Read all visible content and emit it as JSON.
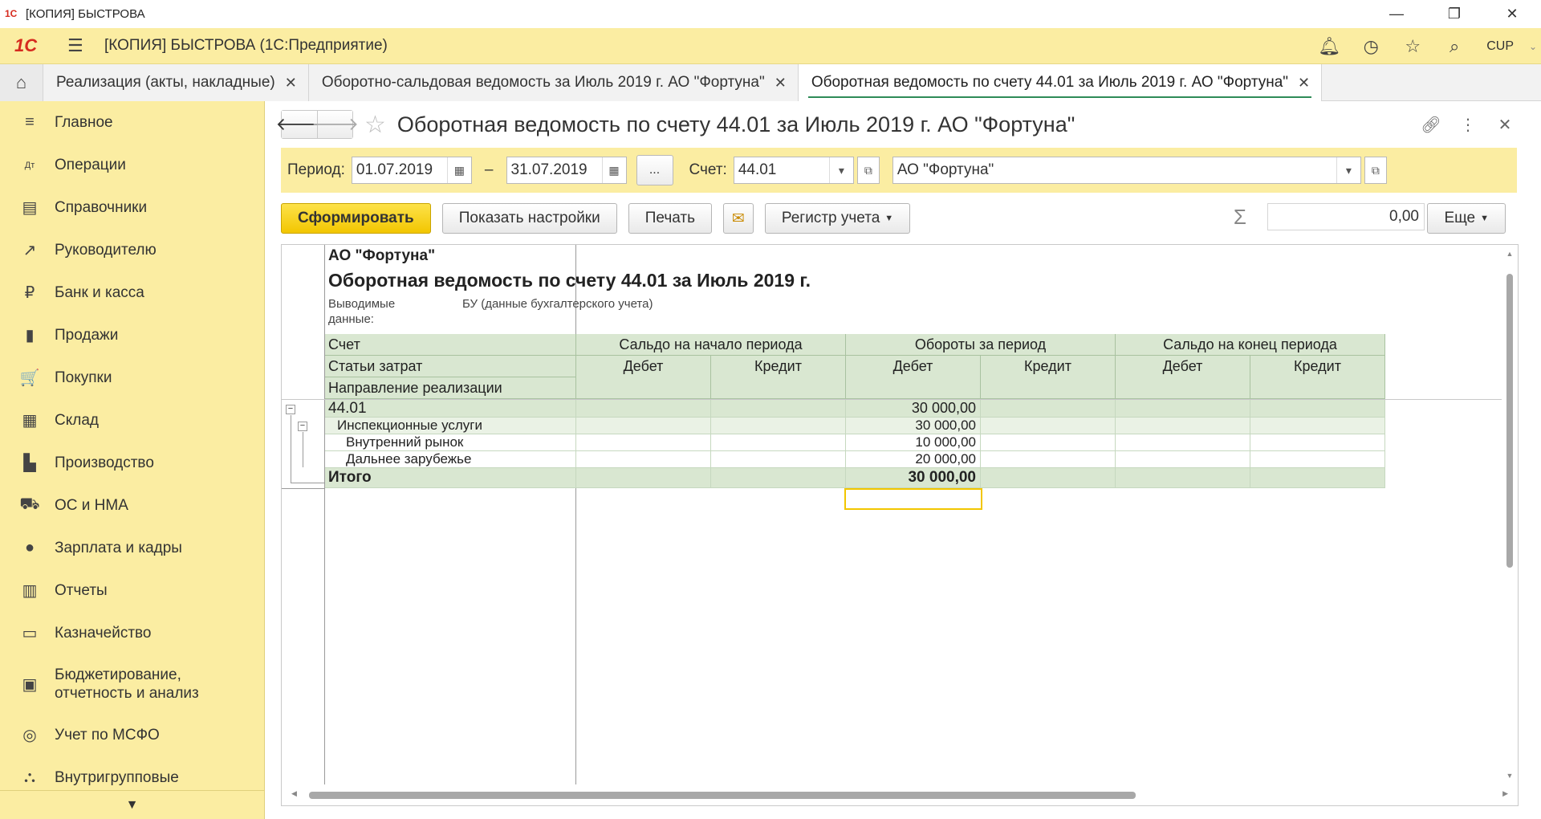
{
  "window": {
    "title": "[КОПИЯ] БЫСТРОВА",
    "min": "—",
    "restore": "❐",
    "close": "✕"
  },
  "app": {
    "logo": "1С",
    "title": "[КОПИЯ] БЫСТРОВА  (1С:Предприятие)",
    "user": "CUP"
  },
  "tabs": [
    {
      "label": "Реализация (акты, накладные)"
    },
    {
      "label": "Оборотно-сальдовая ведомость за Июль 2019 г. АО \"Фортуна\""
    },
    {
      "label": "Оборотная ведомость по счету 44.01 за Июль 2019 г. АО \"Фортуна\""
    }
  ],
  "sidebar": {
    "items": [
      {
        "label": "Главное",
        "icon": "≡"
      },
      {
        "label": "Операции",
        "icon": "Дт"
      },
      {
        "label": "Справочники",
        "icon": "▤"
      },
      {
        "label": "Руководителю",
        "icon": "↗"
      },
      {
        "label": "Банк и касса",
        "icon": "₽"
      },
      {
        "label": "Продажи",
        "icon": "▮"
      },
      {
        "label": "Покупки",
        "icon": "🛒"
      },
      {
        "label": "Склад",
        "icon": "▦"
      },
      {
        "label": "Производство",
        "icon": "▙"
      },
      {
        "label": "ОС и НМА",
        "icon": "⛟"
      },
      {
        "label": "Зарплата и кадры",
        "icon": "●"
      },
      {
        "label": "Отчеты",
        "icon": "▥"
      },
      {
        "label": "Казначейство",
        "icon": "▭"
      },
      {
        "label": "Бюджетирование,\nотчетность и анализ",
        "icon": "▣"
      },
      {
        "label": "Учет по МСФО",
        "icon": "◎"
      },
      {
        "label": "Внутригрупповые",
        "icon": "⛬"
      }
    ],
    "more": "▼"
  },
  "document": {
    "title": "Оборотная ведомость по счету 44.01 за Июль 2019 г. АО \"Фортуна\""
  },
  "filters": {
    "period_label": "Период:",
    "date_from": "01.07.2019",
    "dash": "–",
    "date_to": "31.07.2019",
    "dots": "...",
    "account_label": "Счет:",
    "account": "44.01",
    "organization": "АО \"Фортуна\""
  },
  "toolbar": {
    "generate": "Сформировать",
    "settings": "Показать настройки",
    "print": "Печать",
    "mail": "✉",
    "register": "Регистр учета",
    "sum": "0,00",
    "more": "Еще"
  },
  "report": {
    "org": "АО \"Фортуна\"",
    "title": "Оборотная ведомость по счету 44.01 за Июль 2019 г.",
    "data_label_1": "Выводимые",
    "data_label_2": "данные:",
    "data_value": "БУ (данные бухгалтерского учета)",
    "head_col1": [
      "Счет",
      "Статьи затрат",
      "Направление реализации"
    ],
    "groups": [
      "Сальдо на начало периода",
      "Обороты за период",
      "Сальдо на конец периода"
    ],
    "sub": [
      "Дебет",
      "Кредит",
      "Дебет",
      "Кредит",
      "Дебет",
      "Кредит"
    ],
    "rows": [
      {
        "name": "44.01",
        "od": "30 000,00"
      },
      {
        "name": "Инспекционные услуги",
        "od": "30 000,00"
      },
      {
        "name": "Внутренний рынок",
        "od": "10 000,00"
      },
      {
        "name": "Дальнее зарубежье",
        "od": "20 000,00"
      }
    ],
    "total_label": "Итого",
    "total_od": "30 000,00"
  }
}
